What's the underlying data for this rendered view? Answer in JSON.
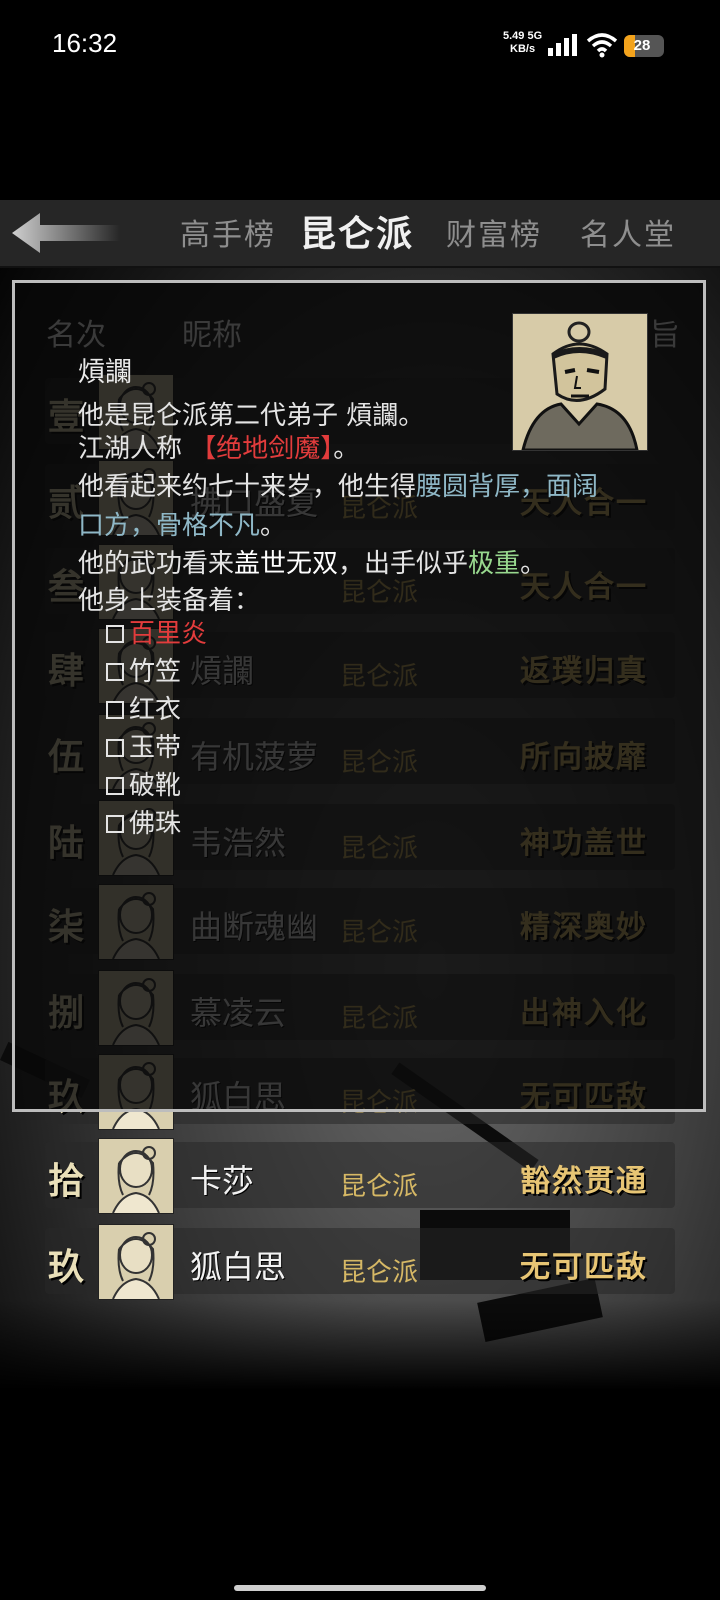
{
  "status": {
    "time": "16:32",
    "net_speed": "5.49",
    "net_unit": "KB/s",
    "net_type": "5G",
    "battery": "28",
    "battery_level": 0.28
  },
  "nav": {
    "tabs": [
      "高手榜",
      "昆仑派",
      "财富榜",
      "名人堂"
    ],
    "active_index": 1
  },
  "table": {
    "headers": [
      "名次",
      "昵称",
      "旨"
    ],
    "rows": [
      {
        "rank": "壹",
        "name": "",
        "sect": "",
        "realm": ""
      },
      {
        "rank": "贰",
        "name": "拂口盛夏",
        "sect": "昆仑派",
        "realm": "天人合一"
      },
      {
        "rank": "叁",
        "name": "",
        "sect": "昆仑派",
        "realm": "天人合一"
      },
      {
        "rank": "肆",
        "name": "熕讕",
        "sect": "昆仑派",
        "realm": "返璞归真"
      },
      {
        "rank": "伍",
        "name": "有机菠萝",
        "sect": "昆仑派",
        "realm": "所向披靡"
      },
      {
        "rank": "陆",
        "name": "韦浩然",
        "sect": "昆仑派",
        "realm": "神功盖世"
      },
      {
        "rank": "柒",
        "name": "曲断魂幽",
        "sect": "昆仑派",
        "realm": "精深奥妙"
      },
      {
        "rank": "捌",
        "name": "慕凌云",
        "sect": "昆仑派",
        "realm": "出神入化"
      },
      {
        "rank": "玖",
        "name": "狐白思",
        "sect": "昆仑派",
        "realm": "无可匹敌"
      },
      {
        "rank": "拾",
        "name": "卡莎",
        "sect": "昆仑派",
        "realm": "豁然贯通"
      },
      {
        "rank": "玖",
        "name": "狐白思",
        "sect": "昆仑派",
        "realm": "无可匹敌"
      }
    ]
  },
  "popup": {
    "title": "熕讕",
    "line1": "他是昆仑派第二代弟子 熕讕。",
    "line2_prefix": "江湖人称 ",
    "line2_nickname": "【绝地剑魔】",
    "line2_suffix": "。",
    "line3_a": "他看起来约七十来岁，他生得",
    "line3_b": "腰圆背厚，面阔",
    "line4_a": "口方，骨格不凡",
    "line4_b": "。",
    "line5_a": "他的武功看来",
    "line5_b": "盖世无双",
    "line5_c": "，出手似乎",
    "line5_d": "极重",
    "line5_e": "。",
    "line6": "他身上装备着：",
    "equipment": [
      "百里炎",
      "竹笠",
      "红衣",
      "玉带",
      "破靴",
      "佛珠"
    ]
  }
}
